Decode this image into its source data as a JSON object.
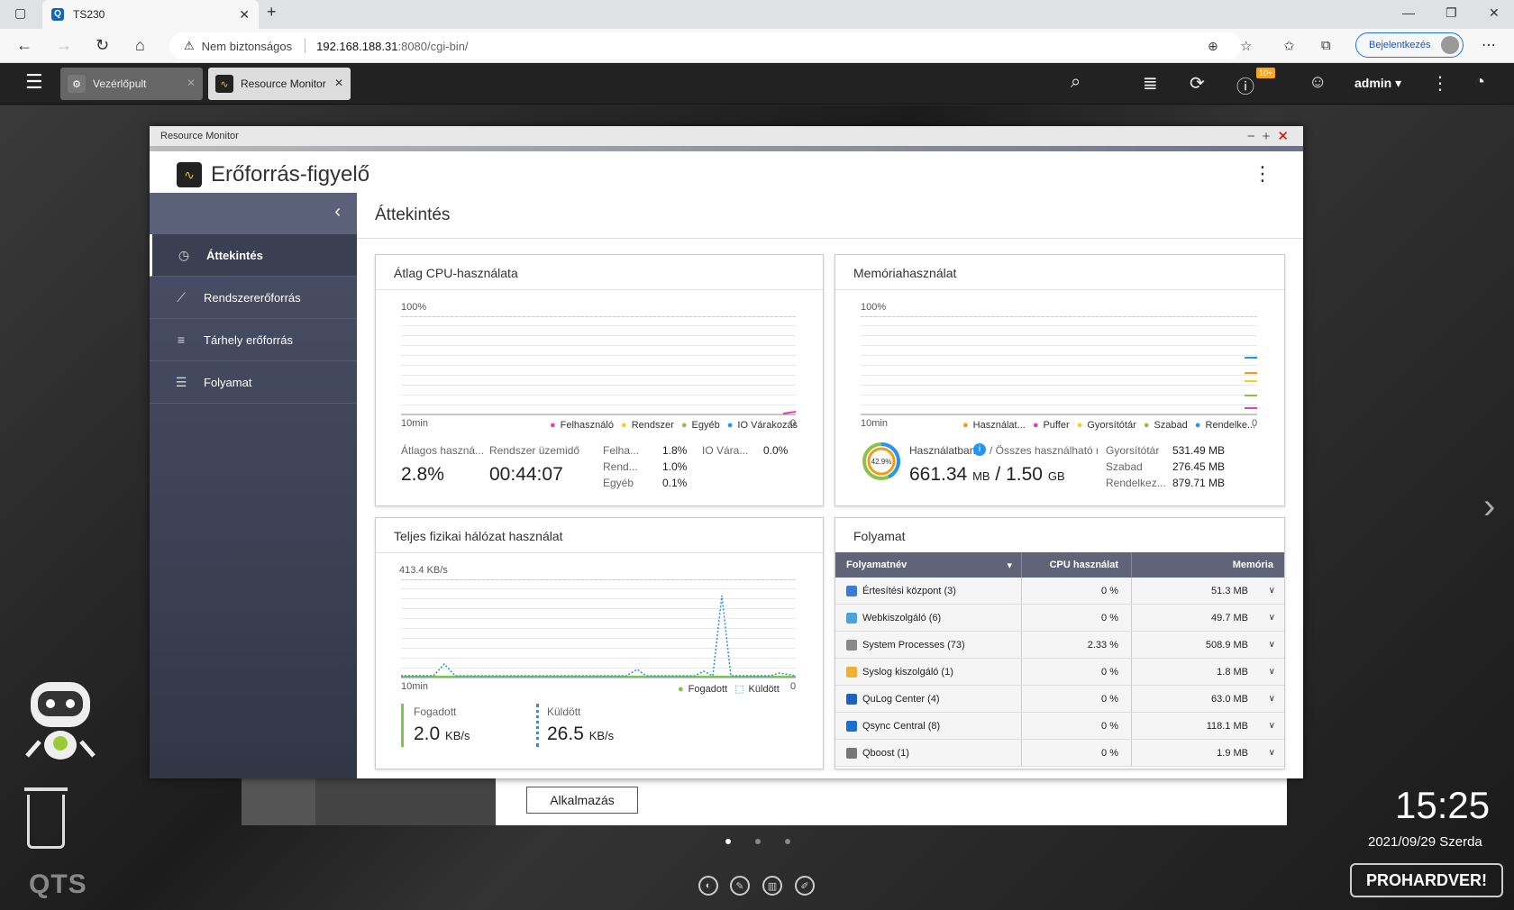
{
  "browser": {
    "tab_title": "TS230",
    "security_text": "Nem biztonságos",
    "url_host": "192.168.188.31",
    "url_rest": ":8080/cgi-bin/",
    "login_label": "Bejelentkezés"
  },
  "qts": {
    "tabs": [
      {
        "label": "Vezérlőpult"
      },
      {
        "label": "Resource Monitor"
      }
    ],
    "notification_badge": "10+",
    "user": "admin",
    "clock": "15:25",
    "date": "2021/09/29 Szerda",
    "brand": "QTS",
    "watermark": "PROHARDVER!",
    "apply_button": "Alkalmazás"
  },
  "window": {
    "title": "Resource Monitor",
    "app_title": "Erőforrás-figyelő"
  },
  "sidebar": {
    "items": [
      {
        "label": "Áttekintés",
        "active": true
      },
      {
        "label": "Rendszererőforrás"
      },
      {
        "label": "Tárhely erőforrás"
      },
      {
        "label": "Folyamat"
      }
    ]
  },
  "content": {
    "title": "Áttekintés"
  },
  "cpu": {
    "title": "Átlag CPU-használata",
    "y_top": "100%",
    "x_left": "10min",
    "x_right": "0",
    "legend": [
      "Felhasználó",
      "Rendszer",
      "Egyéb",
      "IO Várakozás"
    ],
    "avg_label": "Átlagos haszná...",
    "avg_value": "2.8%",
    "uptime_label": "Rendszer üzemidő",
    "uptime_value": "00:44:07",
    "breakdown": [
      {
        "label": "Felha...",
        "value": "1.8%"
      },
      {
        "label": "Rend...",
        "value": "1.0%"
      },
      {
        "label": "Egyéb",
        "value": "0.1%"
      }
    ],
    "io_label": "IO Vára...",
    "io_value": "0.0%"
  },
  "memory": {
    "title": "Memóriahasználat",
    "y_top": "100%",
    "x_left": "10min",
    "x_right": "0",
    "legend": [
      "Használat...",
      "Puffer",
      "Gyorsítótár",
      "Szabad",
      "Rendelke..."
    ],
    "donut_pct": "42.9%",
    "donut_value": 42.9,
    "used_label": "Használatban",
    "total_label": "/ Összes használható me",
    "used_value": "661.34",
    "used_unit": "MB",
    "slash": "/",
    "total_value": "1.50",
    "total_unit": "GB",
    "stats": [
      {
        "label": "Gyorsítótár",
        "value": "531.49 MB"
      },
      {
        "label": "Szabad",
        "value": "276.45 MB"
      },
      {
        "label": "Rendelkez...",
        "value": "879.71 MB"
      }
    ]
  },
  "network": {
    "title": "Teljes fizikai hálózat használat",
    "y_top": "413.4 KB/s",
    "x_left": "10min",
    "x_right": "0",
    "legend": [
      "Fogadott",
      "Küldött"
    ],
    "recv_label": "Fogadott",
    "recv_value": "2.0",
    "recv_unit": "KB/s",
    "sent_label": "Küldött",
    "sent_value": "26.5",
    "sent_unit": "KB/s"
  },
  "process": {
    "title": "Folyamat",
    "headers": [
      "Folyamatnév",
      "CPU használat",
      "Memória"
    ],
    "rows": [
      {
        "name": "Értesítési központ (3)",
        "cpu": "0 %",
        "mem": "51.3 MB",
        "color": "#3a7bd5"
      },
      {
        "name": "Webkiszolgáló (6)",
        "cpu": "0 %",
        "mem": "49.7 MB",
        "color": "#4aa3df"
      },
      {
        "name": "System Processes (73)",
        "cpu": "2.33 %",
        "mem": "508.9 MB",
        "color": "#888888"
      },
      {
        "name": "Syslog kiszolgáló (1)",
        "cpu": "0 %",
        "mem": "1.8 MB",
        "color": "#f0b030"
      },
      {
        "name": "QuLog Center (4)",
        "cpu": "0 %",
        "mem": "63.0 MB",
        "color": "#2060c0"
      },
      {
        "name": "Qsync Central (8)",
        "cpu": "0 %",
        "mem": "118.1 MB",
        "color": "#1a6fd0"
      },
      {
        "name": "Qboost (1)",
        "cpu": "0 %",
        "mem": "1.9 MB",
        "color": "#777777"
      }
    ]
  },
  "colors": {
    "user": "#e040c0",
    "system": "#f0d020",
    "other": "#8bc34a",
    "io": "#2196f3",
    "recv": "#7ac943",
    "sent": "#2b8fe0",
    "accent": "#5f6478"
  }
}
